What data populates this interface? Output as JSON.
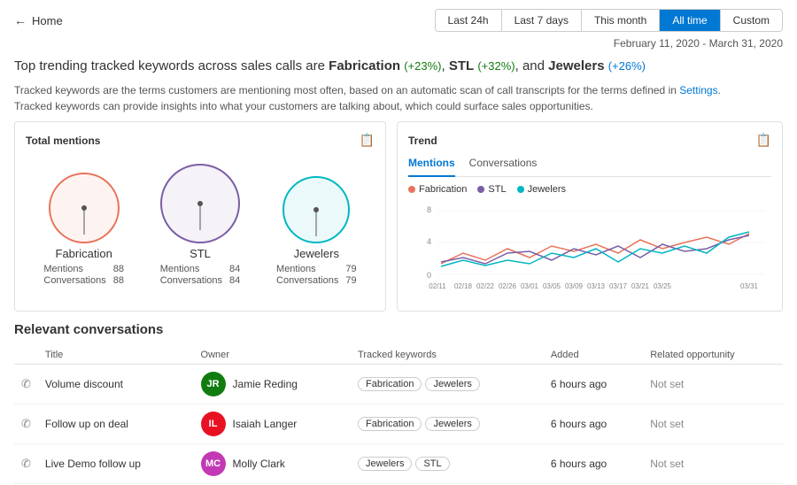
{
  "header": {
    "back_label": "Home",
    "time_filters": [
      {
        "label": "Last 24h",
        "active": false
      },
      {
        "label": "Last 7 days",
        "active": false
      },
      {
        "label": "This month",
        "active": false
      },
      {
        "label": "All time",
        "active": true
      },
      {
        "label": "Custom",
        "active": false
      }
    ]
  },
  "date_range": "February 11, 2020 - March 31, 2020",
  "headline": {
    "prefix": "Top trending tracked keywords across sales calls are ",
    "kw1": "Fabrication",
    "pct1": "(+23%)",
    "sep1": ", ",
    "kw2": "STL",
    "pct2": "(+32%)",
    "sep2": ", and ",
    "kw3": "Jewelers",
    "pct3": "(+26%)"
  },
  "description": {
    "line1": "Tracked keywords are the terms customers are mentioning most often, based on an automatic scan of call transcripts for the terms defined in ",
    "link": "Settings",
    "line1_end": ".",
    "line2": "Tracked keywords can provide insights into what your customers are talking about, which could surface sales opportunities."
  },
  "mentions_panel": {
    "title": "Total mentions",
    "keywords": [
      {
        "name": "Fabrication",
        "circle_class": "circle-fab",
        "mentions": "88",
        "conversations": "88"
      },
      {
        "name": "STL",
        "circle_class": "circle-stl",
        "mentions": "84",
        "conversations": "84"
      },
      {
        "name": "Jewelers",
        "circle_class": "circle-jew",
        "mentions": "79",
        "conversations": "79"
      }
    ],
    "label_mentions": "Mentions",
    "label_conversations": "Conversations"
  },
  "trend_panel": {
    "title": "Trend",
    "tabs": [
      "Mentions",
      "Conversations"
    ],
    "active_tab": "Mentions",
    "legend": [
      {
        "label": "Fabrication",
        "color": "#e8735a"
      },
      {
        "label": "STL",
        "color": "#7b5ea7"
      },
      {
        "label": "Jewelers",
        "color": "#00b7c3"
      }
    ],
    "x_labels": [
      "02/11",
      "02/18",
      "02/22",
      "02/26",
      "03/01",
      "03/05",
      "03/09",
      "03/13",
      "03/17",
      "03/21",
      "03/25",
      "03/31"
    ],
    "y_labels": [
      "8",
      "4",
      "0"
    ]
  },
  "conversations": {
    "section_title": "Relevant conversations",
    "columns": [
      "",
      "Title",
      "Owner",
      "Tracked keywords",
      "Added",
      "Related opportunity"
    ],
    "rows": [
      {
        "title": "Volume discount",
        "owner_initials": "JR",
        "owner_name": "Jamie Reding",
        "owner_color": "#107c10",
        "keywords": [
          "Fabrication",
          "Jewelers"
        ],
        "added": "6 hours ago",
        "opportunity": "Not set"
      },
      {
        "title": "Follow up on deal",
        "owner_initials": "IL",
        "owner_name": "Isaiah Langer",
        "owner_color": "#e81123",
        "keywords": [
          "Fabrication",
          "Jewelers"
        ],
        "added": "6 hours ago",
        "opportunity": "Not set"
      },
      {
        "title": "Live Demo follow up",
        "owner_initials": "MC",
        "owner_name": "Molly Clark",
        "owner_color": "#c239b3",
        "keywords": [
          "Jewelers",
          "STL"
        ],
        "added": "6 hours ago",
        "opportunity": "Not set"
      }
    ]
  }
}
